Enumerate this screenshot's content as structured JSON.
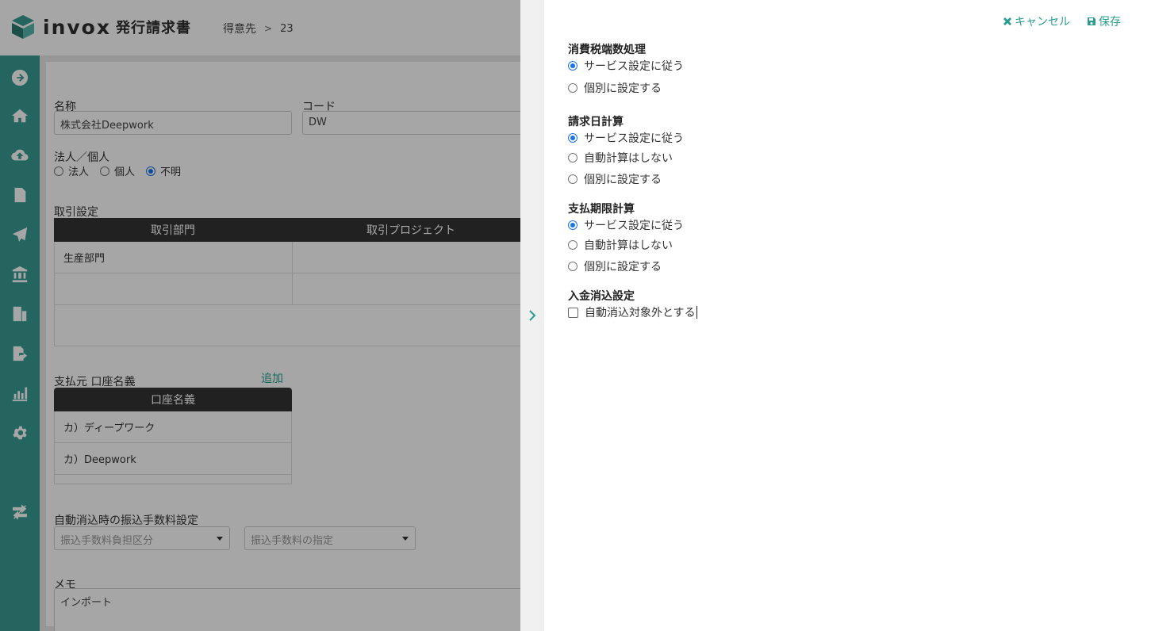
{
  "app": {
    "logo_word": "invox",
    "logo_sub": "発行請求書"
  },
  "breadcrumb": {
    "parent": "得意先",
    "separator": ">",
    "current": "23"
  },
  "sidebar": {
    "icons": [
      "arrow-right-circle-icon",
      "home-icon",
      "cloud-upload-icon",
      "document-icon",
      "send-icon",
      "bank-icon",
      "building-icon",
      "export-file-icon",
      "chart-icon",
      "gear-icon",
      "switch-icon"
    ]
  },
  "form": {
    "name_label": "名称",
    "name_value": "株式会社Deepwork",
    "code_label": "コード",
    "code_value": "DW",
    "entity_label": "法人／個人",
    "entity_options": [
      "法人",
      "個人",
      "不明"
    ],
    "entity_selected": "不明",
    "trade_label": "取引設定",
    "trade_headers": [
      "取引部門",
      "取引プロジェクト"
    ],
    "trade_rows": [
      [
        "生産部門",
        ""
      ],
      [
        "",
        ""
      ]
    ],
    "account_label": "支払元 口座名義",
    "account_add": "追加",
    "account_header": "口座名義",
    "account_rows": [
      "カ）ディープワーク",
      "カ）Deepwork"
    ],
    "fee_label": "自動消込時の振込手数料設定",
    "fee_select_1": "振込手数料負担区分",
    "fee_select_2": "振込手数料の指定",
    "memo_label": "メモ",
    "memo_value": "インポート"
  },
  "drawer": {
    "cancel_label": "キャンセル",
    "save_label": "保存",
    "sections": {
      "tax": {
        "title": "消費税端数処理",
        "options": [
          "サービス設定に従う",
          "個別に設定する"
        ],
        "selected": "サービス設定に従う"
      },
      "billing_date": {
        "title": "請求日計算",
        "options": [
          "サービス設定に従う",
          "自動計算はしない",
          "個別に設定する"
        ],
        "selected": "サービス設定に従う"
      },
      "due_date": {
        "title": "支払期限計算",
        "options": [
          "サービス設定に従う",
          "自動計算はしない",
          "個別に設定する"
        ],
        "selected": "サービス設定に従う"
      },
      "reconcile": {
        "title": "入金消込設定",
        "checkbox_label": "自動消込対象外とする",
        "checked": false
      }
    }
  },
  "colors": {
    "sidebar": "#3a9c92",
    "accent": "#2a9d8f",
    "table_header": "#333333",
    "radio_selected": "#1a73e8"
  }
}
